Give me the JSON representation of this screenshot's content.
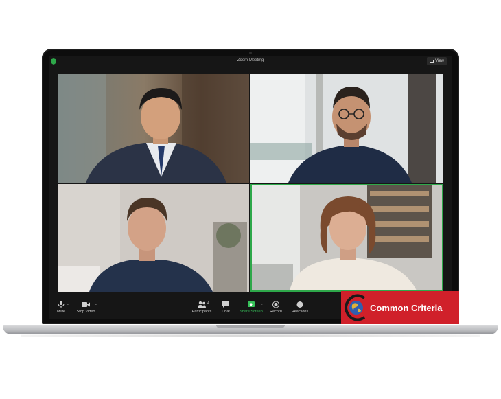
{
  "window": {
    "title": "Zoom Meeting",
    "view_label": "View"
  },
  "participants": [
    {
      "id": "p1",
      "speaking": false
    },
    {
      "id": "p2",
      "speaking": false
    },
    {
      "id": "p3",
      "speaking": false
    },
    {
      "id": "p4",
      "speaking": true
    }
  ],
  "toolbar": {
    "mute": "Mute",
    "stop_video": "Stop Video",
    "participants": "Participants",
    "participants_count": "4",
    "chat": "Chat",
    "share_screen": "Share Screen",
    "record": "Record",
    "reactions": "Reactions"
  },
  "brand": {
    "text": "Common Criteria",
    "color": "#d0202a"
  },
  "colors": {
    "active_speaker": "#2ea84a",
    "share_green": "#37c15a"
  }
}
